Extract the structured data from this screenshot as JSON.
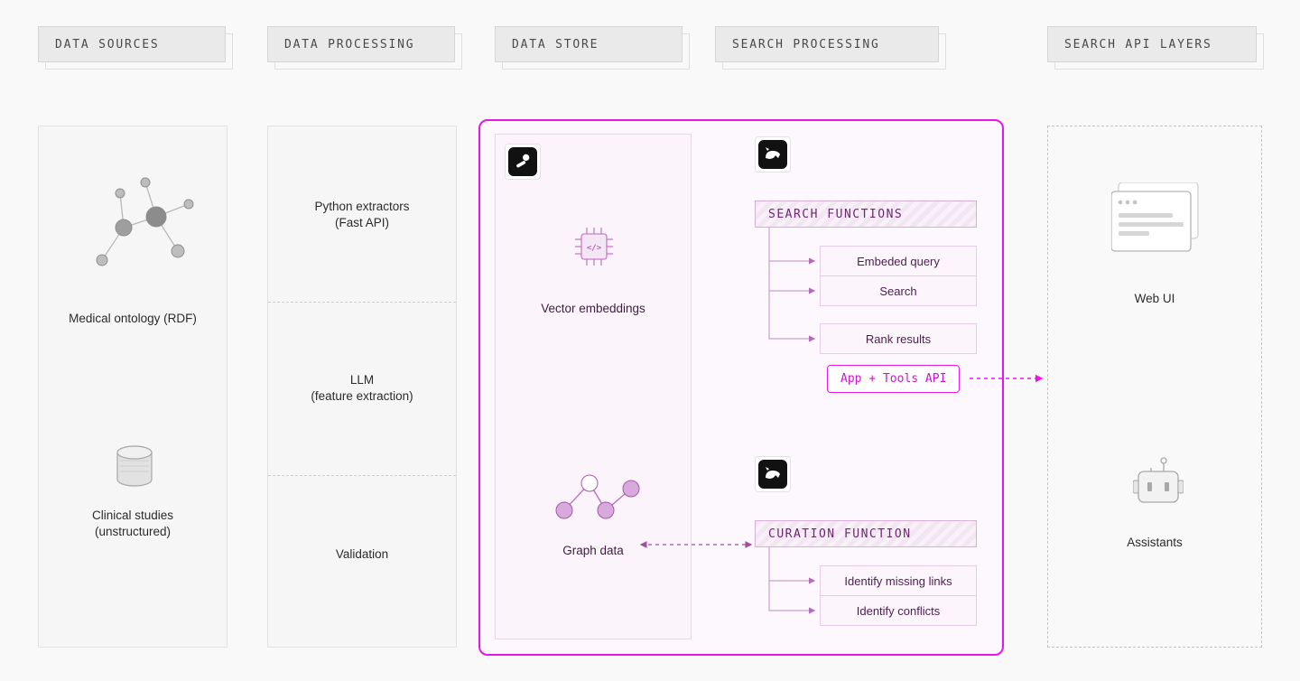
{
  "headers": {
    "col1": "DATA SOURCES",
    "col2": "DATA PROCESSING",
    "col3": "DATA STORE",
    "col4": "SEARCH PROCESSING",
    "col5": "SEARCH API LAYERS"
  },
  "data_sources": {
    "ontology": "Medical ontology (RDF)",
    "studies_l1": "Clinical studies",
    "studies_l2": "(unstructured)"
  },
  "data_processing": {
    "extractors_l1": "Python extractors",
    "extractors_l2": "(Fast API)",
    "llm_l1": "LLM",
    "llm_l2": "(feature extraction)",
    "validation": "Validation"
  },
  "data_store": {
    "vector": "Vector embeddings",
    "graph": "Graph data"
  },
  "search_processing": {
    "search_header": "SEARCH FUNCTIONS",
    "search_items": [
      "Embeded query",
      "Search",
      "Rank results"
    ],
    "api_chip": "App + Tools API",
    "curation_header": "CURATION FUNCTION",
    "curation_items": [
      "Identify missing links",
      "Identify conflicts"
    ]
  },
  "api_layers": {
    "web_ui": "Web UI",
    "assistants": "Assistants"
  },
  "colors": {
    "accent": "#e815e8",
    "purple_text": "#6d2771"
  }
}
